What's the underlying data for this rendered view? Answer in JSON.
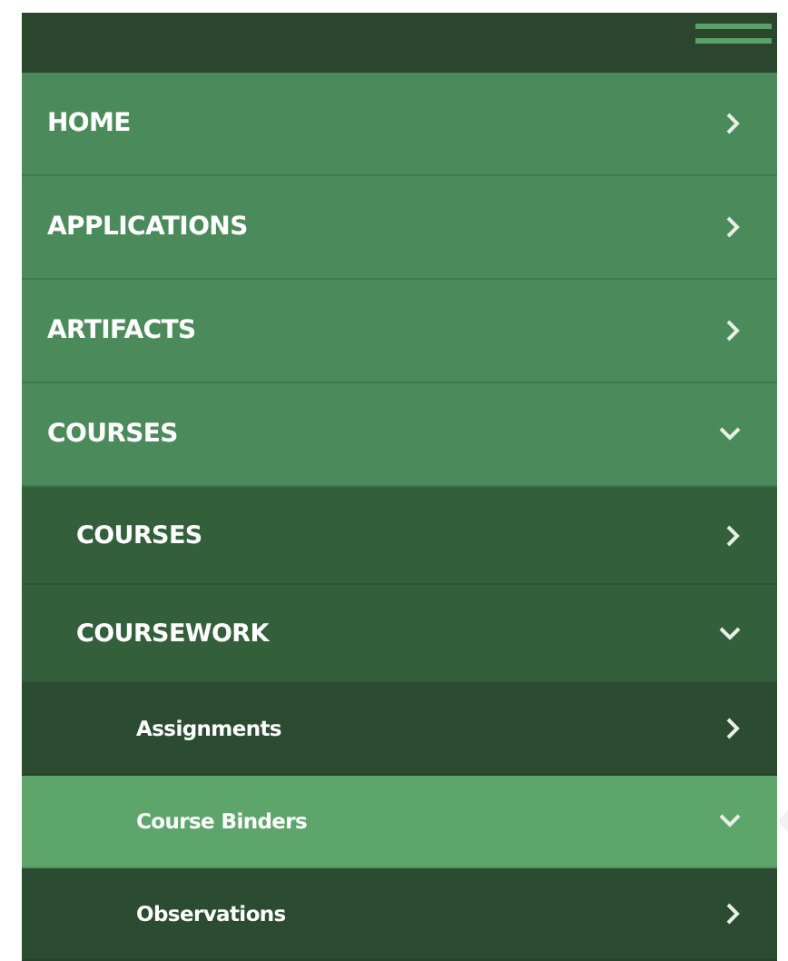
{
  "menu": [
    {
      "label": "HOME",
      "expanded": false,
      "selected": false
    },
    {
      "label": "APPLICATIONS",
      "expanded": false,
      "selected": false
    },
    {
      "label": "ARTIFACTS",
      "expanded": false,
      "selected": false
    },
    {
      "label": "COURSES",
      "expanded": true,
      "selected": false,
      "children": [
        {
          "label": "COURSES",
          "expanded": false,
          "selected": false
        },
        {
          "label": "COURSEWORK",
          "expanded": true,
          "selected": false,
          "children": [
            {
              "label": "Assignments",
              "expanded": false,
              "selected": false
            },
            {
              "label": "Course Binders",
              "expanded": true,
              "selected": true
            },
            {
              "label": "Observations",
              "expanded": false,
              "selected": false
            }
          ]
        }
      ]
    }
  ]
}
